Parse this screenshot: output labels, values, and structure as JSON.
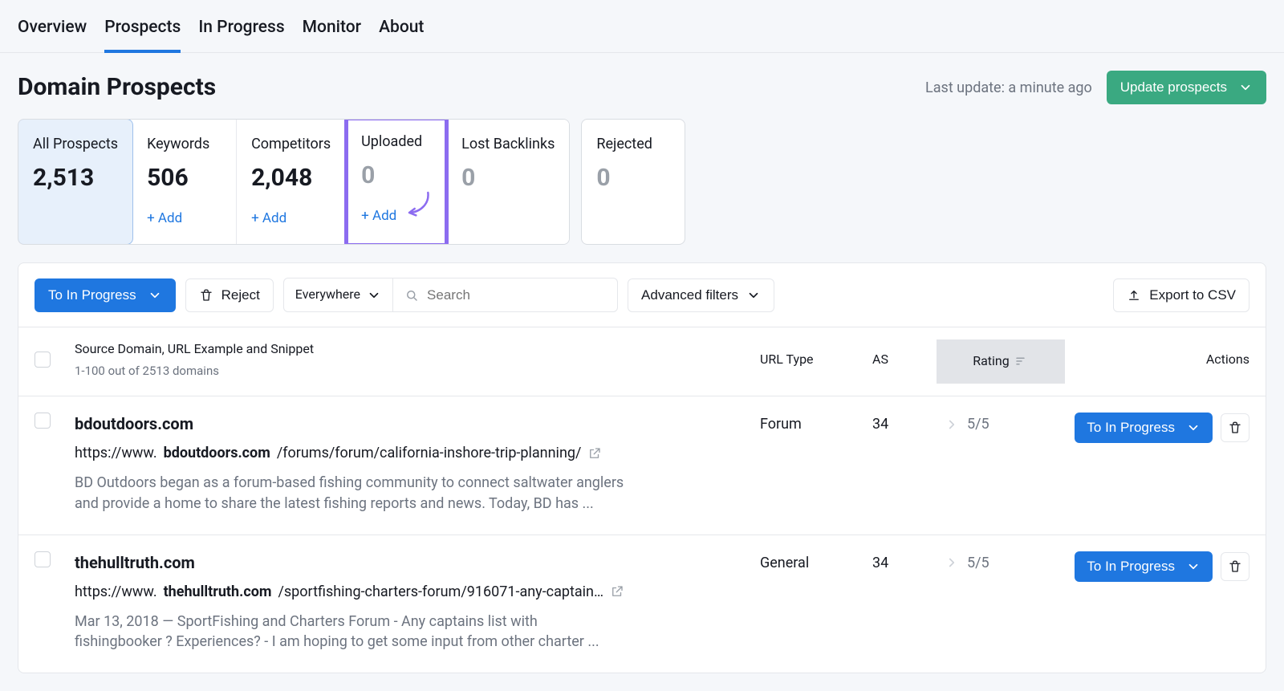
{
  "nav": {
    "tabs": [
      "Overview",
      "Prospects",
      "In Progress",
      "Monitor",
      "About"
    ],
    "active": 1
  },
  "header": {
    "title": "Domain Prospects",
    "last_update": "Last update: a minute ago",
    "update_btn": "Update prospects"
  },
  "cards": [
    {
      "key": "all",
      "label": "All Prospects",
      "value": "2,513",
      "muted": false,
      "add": false,
      "selected": true,
      "highlight": false
    },
    {
      "key": "keywords",
      "label": "Keywords",
      "value": "506",
      "muted": false,
      "add": true,
      "selected": false,
      "highlight": false
    },
    {
      "key": "competitors",
      "label": "Competitors",
      "value": "2,048",
      "muted": false,
      "add": true,
      "selected": false,
      "highlight": false
    },
    {
      "key": "uploaded",
      "label": "Uploaded",
      "value": "0",
      "muted": true,
      "add": true,
      "selected": false,
      "highlight": true
    },
    {
      "key": "lost",
      "label": "Lost Backlinks",
      "value": "0",
      "muted": true,
      "add": false,
      "selected": false,
      "highlight": false
    }
  ],
  "rejected_card": {
    "label": "Rejected",
    "value": "0",
    "muted": true
  },
  "add_label": "+ Add",
  "toolbar": {
    "to_in_progress": "To In Progress",
    "reject": "Reject",
    "scope": "Everywhere",
    "search_placeholder": "Search",
    "advanced": "Advanced filters",
    "export": "Export to CSV"
  },
  "columns": {
    "source": "Source Domain, URL Example and Snippet",
    "source_sub": "1-100 out of 2513 domains",
    "url_type": "URL Type",
    "as": "AS",
    "rating": "Rating",
    "actions": "Actions"
  },
  "row_action": "To In Progress",
  "rows": [
    {
      "domain": "bdoutdoors.com",
      "url_prefix": "https://www.",
      "url_host": "bdoutdoors.com",
      "url_path": "/forums/forum/california-inshore-trip-planning/",
      "snippet": "BD Outdoors began as a forum-based fishing community to connect saltwater anglers and provide a home to share the latest fishing reports and news. Today, BD has ...",
      "url_type": "Forum",
      "as": "34",
      "rating": "5/5"
    },
    {
      "domain": "thehulltruth.com",
      "url_prefix": "https://www.",
      "url_host": "thehulltruth.com",
      "url_path": "/sportfishing-charters-forum/916071-any-captain…",
      "snippet": "Mar 13, 2018 — SportFishing and Charters Forum - Any captains list with fishingbooker ? Experiences? - I am hoping to get some input from other charter ...",
      "url_type": "General",
      "as": "34",
      "rating": "5/5"
    }
  ]
}
